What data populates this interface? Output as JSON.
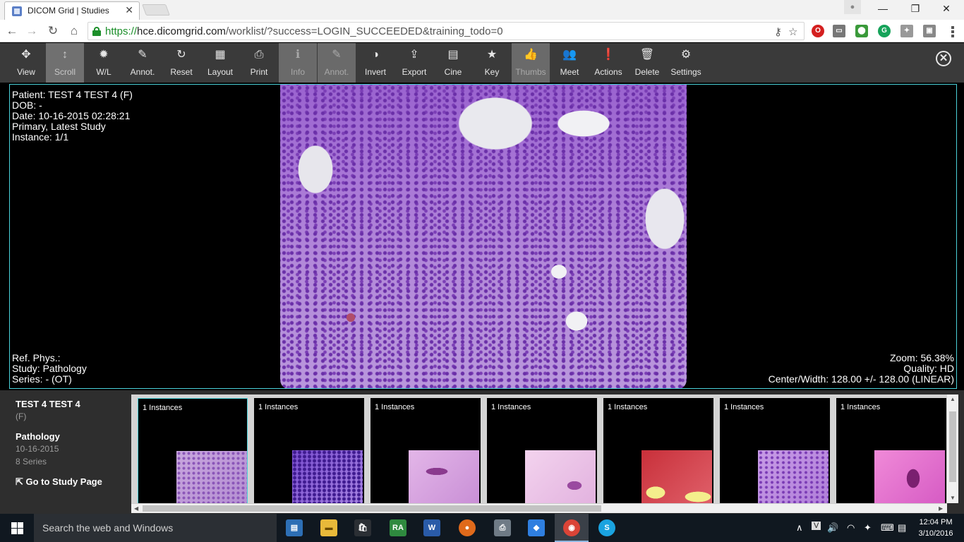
{
  "browser": {
    "tab_title": "DICOM Grid | Studies",
    "tab_close": "✕",
    "url_scheme": "https://",
    "url_host": "hce.dicomgrid.com",
    "url_rest": "/worklist/?success=LOGIN_SUCCEEDED&training_todo=0",
    "window_controls": [
      "—",
      "❐",
      "✕"
    ]
  },
  "toolbar": {
    "tools": [
      {
        "label": "View",
        "icon": "✥",
        "state": "normal"
      },
      {
        "label": "Scroll",
        "icon": "↕",
        "state": "active"
      },
      {
        "label": "W/L",
        "icon": "✹",
        "state": "normal"
      },
      {
        "label": "Annot.",
        "icon": "✎",
        "state": "normal"
      },
      {
        "label": "Reset",
        "icon": "↻",
        "state": "normal"
      },
      {
        "label": "Layout",
        "icon": "▦",
        "state": "normal"
      },
      {
        "label": "Print",
        "icon": "⎙",
        "state": "normal"
      },
      {
        "label": "Info",
        "icon": "ℹ",
        "state": "disabled"
      },
      {
        "label": "Annot.",
        "icon": "✎",
        "state": "disabled"
      },
      {
        "label": "Invert",
        "icon": "◑",
        "state": "normal"
      },
      {
        "label": "Export",
        "icon": "⇪",
        "state": "normal"
      },
      {
        "label": "Cine",
        "icon": "▤",
        "state": "normal"
      },
      {
        "label": "Key",
        "icon": "★",
        "state": "normal"
      },
      {
        "label": "Thumbs",
        "icon": "👍",
        "state": "disabled"
      },
      {
        "label": "Meet",
        "icon": "👥",
        "state": "normal"
      },
      {
        "label": "Actions",
        "icon": "❗",
        "state": "normal"
      },
      {
        "label": "Delete",
        "icon": "🗑",
        "state": "normal"
      },
      {
        "label": "Settings",
        "icon": "⚙",
        "state": "normal"
      }
    ],
    "close_icon": "✕"
  },
  "viewer": {
    "top_left": [
      "Patient: TEST 4 TEST 4 (F)",
      "DOB: -",
      "Date: 10-16-2015 02:28:21",
      "Primary, Latest Study",
      "Instance: 1/1"
    ],
    "bottom_left": [
      "Ref. Phys.:",
      "Study: Pathology",
      "Series: - (OT)"
    ],
    "bottom_right": [
      "Zoom: 56.38%",
      "Quality: HD",
      "Center/Width: 128.00 +/- 128.00 (LINEAR)"
    ]
  },
  "study": {
    "patient_name": "TEST 4 TEST 4",
    "sex": "(F)",
    "modality": "Pathology",
    "date": "10-16-2015",
    "series_count": "8 Series",
    "go_to_link": "Go to Study Page"
  },
  "thumbnails": [
    {
      "label": "1 Instances",
      "tone": "lavender",
      "selected": true
    },
    {
      "label": "1 Instances",
      "tone": "purple",
      "selected": false
    },
    {
      "label": "1 Instances",
      "tone": "pink-light",
      "selected": false
    },
    {
      "label": "1 Instances",
      "tone": "pink-pale",
      "selected": false
    },
    {
      "label": "1 Instances",
      "tone": "red-yellow",
      "selected": false
    },
    {
      "label": "1 Instances",
      "tone": "violet",
      "selected": false
    },
    {
      "label": "1 Instances",
      "tone": "magenta",
      "selected": false
    }
  ],
  "taskbar": {
    "search_placeholder": "Search the web and Windows",
    "time": "12:04 PM",
    "date": "3/10/2016"
  }
}
